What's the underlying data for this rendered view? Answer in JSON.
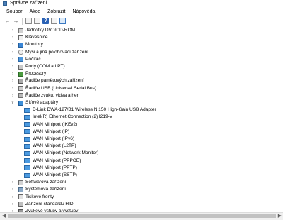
{
  "window": {
    "title": "Správce zařízení"
  },
  "menu": [
    "Soubor",
    "Akce",
    "Zobrazit",
    "Nápověda"
  ],
  "toolbar": {
    "help_glyph": "?"
  },
  "tree": [
    {
      "label": "Jednotky DVD/CD-ROM",
      "icon": "disk-drive-icon",
      "expanded": false
    },
    {
      "label": "Klávesnice",
      "icon": "keyboard-icon",
      "expanded": false
    },
    {
      "label": "Monitory",
      "icon": "monitor-icon",
      "expanded": false
    },
    {
      "label": "Myši a jiná polohovací zařízení",
      "icon": "mouse-icon",
      "expanded": false
    },
    {
      "label": "Počítač",
      "icon": "computer-icon",
      "expanded": false
    },
    {
      "label": "Porty (COM a LPT)",
      "icon": "port-icon",
      "expanded": false
    },
    {
      "label": "Procesory",
      "icon": "processor-icon",
      "expanded": false
    },
    {
      "label": "Řadiče paměťových zařízení",
      "icon": "storage-controller-icon",
      "expanded": false
    },
    {
      "label": "Řadiče USB (Universal Serial Bus)",
      "icon": "usb-icon",
      "expanded": false
    },
    {
      "label": "Řadiče zvuku, videa a her",
      "icon": "sound-icon",
      "expanded": false
    },
    {
      "label": "Síťové adaptéry",
      "icon": "network-icon",
      "expanded": true,
      "children": [
        "D-Link DWA-127/B1 Wireless N 150 High-Gain USB Adapter",
        "Intel(R) Ethernet Connection (2) I219-V",
        "WAN Miniport (IKEv2)",
        "WAN Miniport (IP)",
        "WAN Miniport (IPv6)",
        "WAN Miniport (L2TP)",
        "WAN Miniport (Network Monitor)",
        "WAN Miniport (PPPOE)",
        "WAN Miniport (PPTP)",
        "WAN Miniport (SSTP)"
      ]
    },
    {
      "label": "Softwarová zařízení",
      "icon": "software-device-icon",
      "expanded": false
    },
    {
      "label": "Systémová zařízení",
      "icon": "system-device-icon",
      "expanded": false
    },
    {
      "label": "Tiskové fronty",
      "icon": "printer-icon",
      "expanded": false
    },
    {
      "label": "Zařízení standardu HID",
      "icon": "hid-icon",
      "expanded": false
    },
    {
      "label": "Zvukové vstupy a výstupy",
      "icon": "audio-io-icon",
      "expanded": false
    }
  ]
}
